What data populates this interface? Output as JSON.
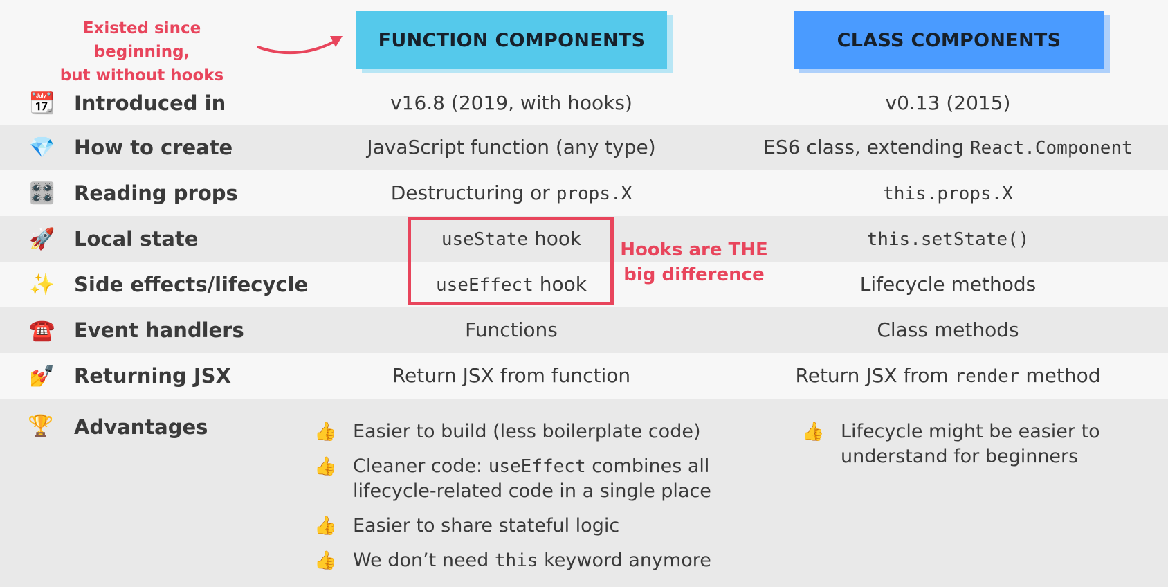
{
  "annotation": {
    "line1": "Existed since beginning,",
    "line2": "but without hooks"
  },
  "headers": {
    "function": "FUNCTION COMPONENTS",
    "class": "CLASS COMPONENTS"
  },
  "rows": [
    {
      "icon": "calendar-icon",
      "emoji": "📆",
      "label": "Introduced in",
      "fc": [
        "v16.8 (2019, with hooks)"
      ],
      "cc": [
        "v0.13 (2015)"
      ]
    },
    {
      "icon": "gem-icon",
      "emoji": "💎",
      "label": "How to create",
      "fc": [
        "JavaScript function (any type)"
      ],
      "cc": [
        "ES6 class, extending ",
        "React.Component"
      ]
    },
    {
      "icon": "control-knobs-icon",
      "emoji": "🎛️",
      "label": "Reading props",
      "fc": [
        "Destructuring or ",
        "props.X"
      ],
      "cc": [
        "this.props.X"
      ]
    },
    {
      "icon": "rocket-icon",
      "emoji": "🚀",
      "label": "Local state",
      "fc": [
        "useState",
        " hook"
      ],
      "cc": [
        "this.setState()"
      ]
    },
    {
      "icon": "sparkles-icon",
      "emoji": "✨",
      "label": "Side effects/lifecycle",
      "fc": [
        "useEffect",
        " hook"
      ],
      "cc": [
        "Lifecycle methods"
      ]
    },
    {
      "icon": "telephone-icon",
      "emoji": "☎️",
      "label": "Event handlers",
      "fc": [
        "Functions"
      ],
      "cc": [
        "Class methods"
      ]
    },
    {
      "icon": "nail-polish-icon",
      "emoji": "💅",
      "label": "Returning JSX",
      "fc": [
        "Return JSX from function"
      ],
      "cc": [
        "Return JSX from ",
        "render",
        " method"
      ]
    }
  ],
  "hooks_note": {
    "line1": "Hooks are THE",
    "line2": "big difference"
  },
  "advantages": {
    "icon": "trophy-icon",
    "emoji": "🏆",
    "label": "Advantages",
    "thumb": "👍",
    "function": [
      {
        "parts": [
          "Easier to build (less boilerplate code)"
        ]
      },
      {
        "parts": [
          "Cleaner code: ",
          "useEffect",
          " combines all lifecycle-related code in a single place"
        ]
      },
      {
        "parts": [
          "Easier to share stateful logic"
        ]
      },
      {
        "parts": [
          "We don’t need ",
          "this",
          " keyword anymore"
        ]
      }
    ],
    "class": [
      {
        "parts": [
          "Lifecycle might be easier to understand for beginners"
        ]
      }
    ]
  },
  "colors": {
    "function_header": "#55c9eb",
    "class_header": "#4a9bff",
    "accent_red": "#e8455c"
  }
}
